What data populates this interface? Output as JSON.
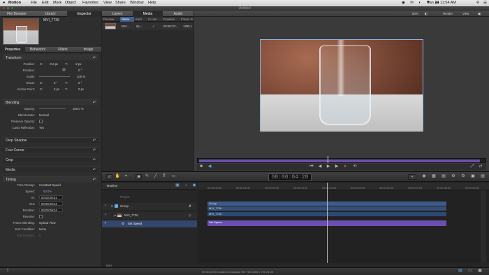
{
  "menubar": {
    "apple": "",
    "app": "Motion",
    "items": [
      "File",
      "Edit",
      "Mark",
      "Object",
      "Favorites",
      "View",
      "Share",
      "Window",
      "Help"
    ],
    "clock": "Jan 24  11:54 AM"
  },
  "window": {
    "title": "Untitled"
  },
  "left_tabs": [
    "File Browser",
    "Library",
    "Inspector"
  ],
  "clip": {
    "name": "MVI_7736"
  },
  "inspector_tabs": [
    "Properties",
    "Behaviors",
    "Filters",
    "Image"
  ],
  "transform": {
    "header": "Transform",
    "position": {
      "label": "Position:",
      "x_label": "X:",
      "x": "-0.2 px",
      "y_label": "Y:",
      "y": "-2 px"
    },
    "rotation": {
      "label": "Rotation:",
      "value": "0 °"
    },
    "scale": {
      "label": "Scale:",
      "value": "100 %"
    },
    "shear": {
      "label": "Shear:",
      "x_label": "X:",
      "x": "0 °",
      "y_label": "Y:",
      "y": "0 °"
    },
    "anchor": {
      "label": "Anchor Point:",
      "x_label": "X:",
      "x": "0 px",
      "y_label": "Y:",
      "y": "0 px"
    }
  },
  "blending": {
    "header": "Blending",
    "opacity": {
      "label": "Opacity:",
      "value": "100.0 %"
    },
    "blend_mode": {
      "label": "Blend Mode:",
      "value": "Normal"
    },
    "preserve_opacity": {
      "label": "Preserve Opacity:"
    },
    "casts_reflection": {
      "label": "Casts Reflection:",
      "value": "Yes"
    }
  },
  "sections": [
    "Drop Shadow",
    "Four Corner",
    "Crop",
    "Media"
  ],
  "timing": {
    "header": "Timing",
    "time_remap": {
      "label": "Time Remap:",
      "value": "Constant Speed"
    },
    "speed": {
      "label": "Speed:",
      "value": "50.0%"
    },
    "in": {
      "label": "In:",
      "value": "00:00:00:01"
    },
    "out": {
      "label": "Out:",
      "value": "00:00:09:24"
    },
    "duration": {
      "label": "Duration:",
      "value": "00:00:09:24"
    },
    "reverse": {
      "label": "Reverse:"
    },
    "frame_blending": {
      "label": "Frame Blending:",
      "value": "Optical Flow"
    },
    "end_condition": {
      "label": "End Condition:",
      "value": "None"
    },
    "end_duration": {
      "label": "End Duration:",
      "value": "0"
    }
  },
  "media_tabs": [
    "Layers",
    "Media",
    "Audio"
  ],
  "media_columns": [
    "Preview",
    "Name",
    "Kind",
    "In Use",
    "Duration",
    "Frame Si"
  ],
  "media_row": {
    "name": "MVI...",
    "kind": "Qu...",
    "in_use": "✓",
    "duration": "00:00:10:...",
    "frame": "1280 x"
  },
  "canvas_bar": {
    "zoom": "50%",
    "render": "Render",
    "view": "View"
  },
  "transport": {
    "timecode": "00:00:04:28"
  },
  "timeline": {
    "label": "Timeline",
    "project": "Project",
    "layers": [
      {
        "name": "Group",
        "type": "group"
      },
      {
        "name": "MVI_7736",
        "type": "clip"
      },
      {
        "name": "Set Speed",
        "type": "behavior"
      }
    ],
    "ruler": [
      "00:00:00:00",
      "00:00:01:00",
      "00:00:02:00",
      "00:00:03:00",
      "00:00:04:00",
      "00:00:05:00",
      "00:00:06:00",
      "00:00:07:00",
      "00:00:08:00",
      "00:00:09:00"
    ],
    "bars": [
      {
        "label": "Group",
        "color": "#3d5b88"
      },
      {
        "label": "MVI_7736",
        "color": "#3d5b88"
      },
      {
        "label": "MVI_7736",
        "color": "#2e4a73"
      },
      {
        "label": "Set Speed",
        "color": "#6a4fb0"
      }
    ],
    "mini_label": "Mini"
  },
  "status": {
    "text": "00:00:10:00 duration broadcast HD 720 1280 x 720 24.00"
  }
}
